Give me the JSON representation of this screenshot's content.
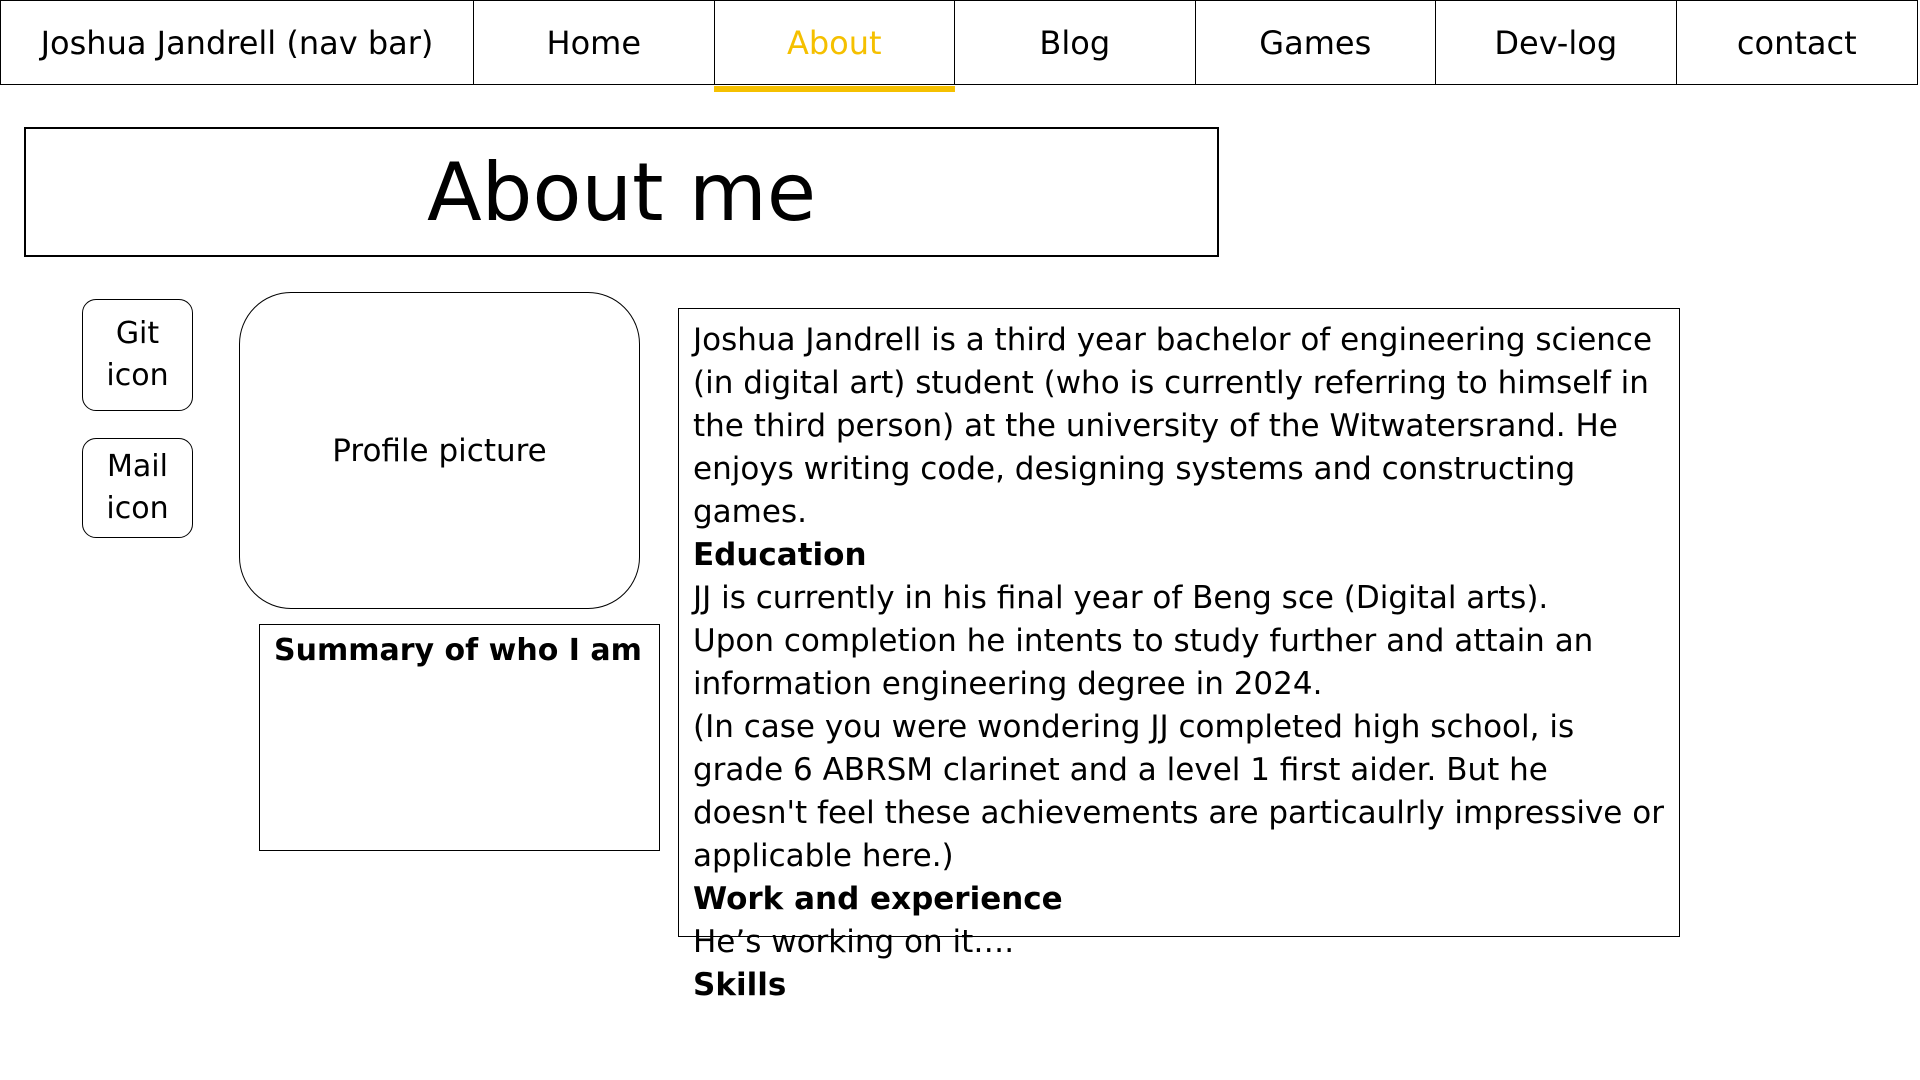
{
  "nav": {
    "brand": "Joshua Jandrell (nav bar)",
    "items": [
      {
        "label": "Home"
      },
      {
        "label": "About"
      },
      {
        "label": "Blog"
      },
      {
        "label": "Games"
      },
      {
        "label": "Dev-log"
      },
      {
        "label": "contact"
      }
    ],
    "active_color": "#f5c000"
  },
  "page": {
    "title": "About me"
  },
  "icons": {
    "git": {
      "line1": "Git",
      "line2": "icon"
    },
    "mail": {
      "line1": "Mail",
      "line2": "icon"
    }
  },
  "profile": {
    "label": "Profile picture"
  },
  "summary": {
    "heading": "Summary of who I am"
  },
  "content": {
    "intro": "Joshua Jandrell is a third year bachelor of engineering science (in digital art) student (who is currently referring to himself in the third person) at the university of the Witwatersrand. He enjoys writing code, designing systems and constructing games.",
    "education_heading": "Education",
    "education_line1": "JJ is currently in his final year of Beng sce (Digital arts).",
    "education_line2": "Upon completion he intents to study further and attain an information engineering degree in 2024.",
    "education_line3": "(In case you were wondering JJ completed high school, is grade 6 ABRSM clarinet and a level 1 first aider. But he doesn't feel these achievements are particaulrly impressive or applicable here.)",
    "work_heading": "Work and experience",
    "work_text": "He’s working on it….",
    "skills_heading": "Skills"
  }
}
